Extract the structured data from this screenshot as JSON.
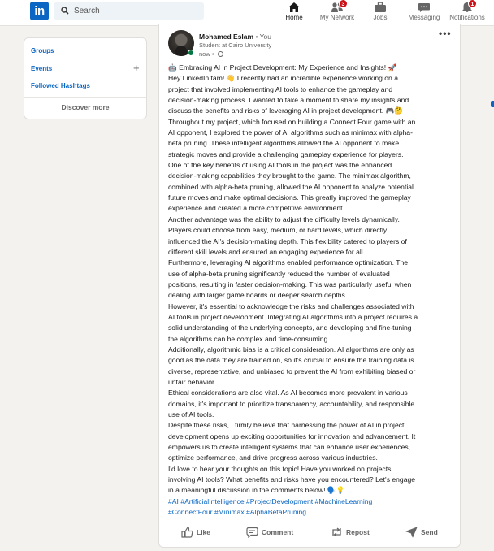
{
  "nav": {
    "logo": "in",
    "search_placeholder": "Search",
    "items": [
      {
        "label": "Home",
        "badge": ""
      },
      {
        "label": "My Network",
        "badge": "3"
      },
      {
        "label": "Jobs",
        "badge": ""
      },
      {
        "label": "Messaging",
        "badge": ""
      },
      {
        "label": "Notifications",
        "badge": "1"
      }
    ]
  },
  "sidebar": {
    "links": [
      "Groups",
      "Events",
      "Followed Hashtags"
    ],
    "add": "+",
    "discover": "Discover more"
  },
  "post": {
    "author": "Mohamed Eslam",
    "you": " • You",
    "headline": "Student at Cairo University",
    "time": "now • ",
    "more": "•••",
    "lines": [
      "🤖 Embracing AI in Project Development: My Experience and Insights! 🚀",
      "Hey LinkedIn fam! 👋 I recently had an incredible experience working on a",
      "project that involved implementing AI tools to enhance the gameplay and",
      "decision-making process. I wanted to take a moment to share my insights and",
      "discuss the benefits and risks of leveraging AI in project development. 🎮🤔",
      "Throughout my project, which focused on building a Connect Four game with an",
      "AI opponent, I explored the power of AI algorithms such as minimax with alpha-",
      "beta pruning. These intelligent algorithms allowed the AI opponent to make",
      "strategic moves and provide a challenging gameplay experience for players.",
      "One of the key benefits of using AI tools in the project was the enhanced",
      "decision-making capabilities they brought to the game. The minimax algorithm,",
      "combined with alpha-beta pruning, allowed the AI opponent to analyze potential",
      "future moves and make optimal decisions. This greatly improved the gameplay",
      "experience and created a more competitive environment.",
      "Another advantage was the ability to adjust the difficulty levels dynamically.",
      "Players could choose from easy, medium, or hard levels, which directly",
      "influenced the AI's decision-making depth. This flexibility catered to players of",
      "different skill levels and ensured an engaging experience for all.",
      "Furthermore, leveraging AI algorithms enabled performance optimization. The",
      "use of alpha-beta pruning significantly reduced the number of evaluated",
      "positions, resulting in faster decision-making. This was particularly useful when",
      "dealing with larger game boards or deeper search depths.",
      "However, it's essential to acknowledge the risks and challenges associated with",
      "AI tools in project development. Integrating AI algorithms into a project requires a",
      "solid understanding of the underlying concepts, and developing and fine-tuning",
      "the algorithms can be complex and time-consuming.",
      "Additionally, algorithmic bias is a critical consideration. AI algorithms are only as",
      "good as the data they are trained on, so it's crucial to ensure the training data is",
      "diverse, representative, and unbiased to prevent the AI from exhibiting biased or",
      "unfair behavior.",
      "Ethical considerations are also vital. As AI becomes more prevalent in various",
      "domains, it's important to prioritize transparency, accountability, and responsible",
      "use of AI tools.",
      "Despite these risks, I firmly believe that harnessing the power of AI in project",
      "development opens up exciting opportunities for innovation and advancement. It",
      "empowers us to create intelligent systems that can enhance user experiences,",
      "optimize performance, and drive progress across various industries.",
      "I'd love to hear your thoughts on this topic! Have you worked on projects",
      "involving AI tools? What benefits and risks have you encountered? Let's engage",
      "in a meaningful discussion in the comments below! 🗣️💡"
    ],
    "hashtags": [
      [
        "#AI",
        "#ArtificialIntelligence",
        "#ProjectDevelopment",
        "#MachineLearning"
      ],
      [
        "#ConnectFour",
        "#Minimax",
        "#AlphaBetaPruning"
      ]
    ],
    "actions": [
      "Like",
      "Comment",
      "Repost",
      "Send"
    ]
  }
}
